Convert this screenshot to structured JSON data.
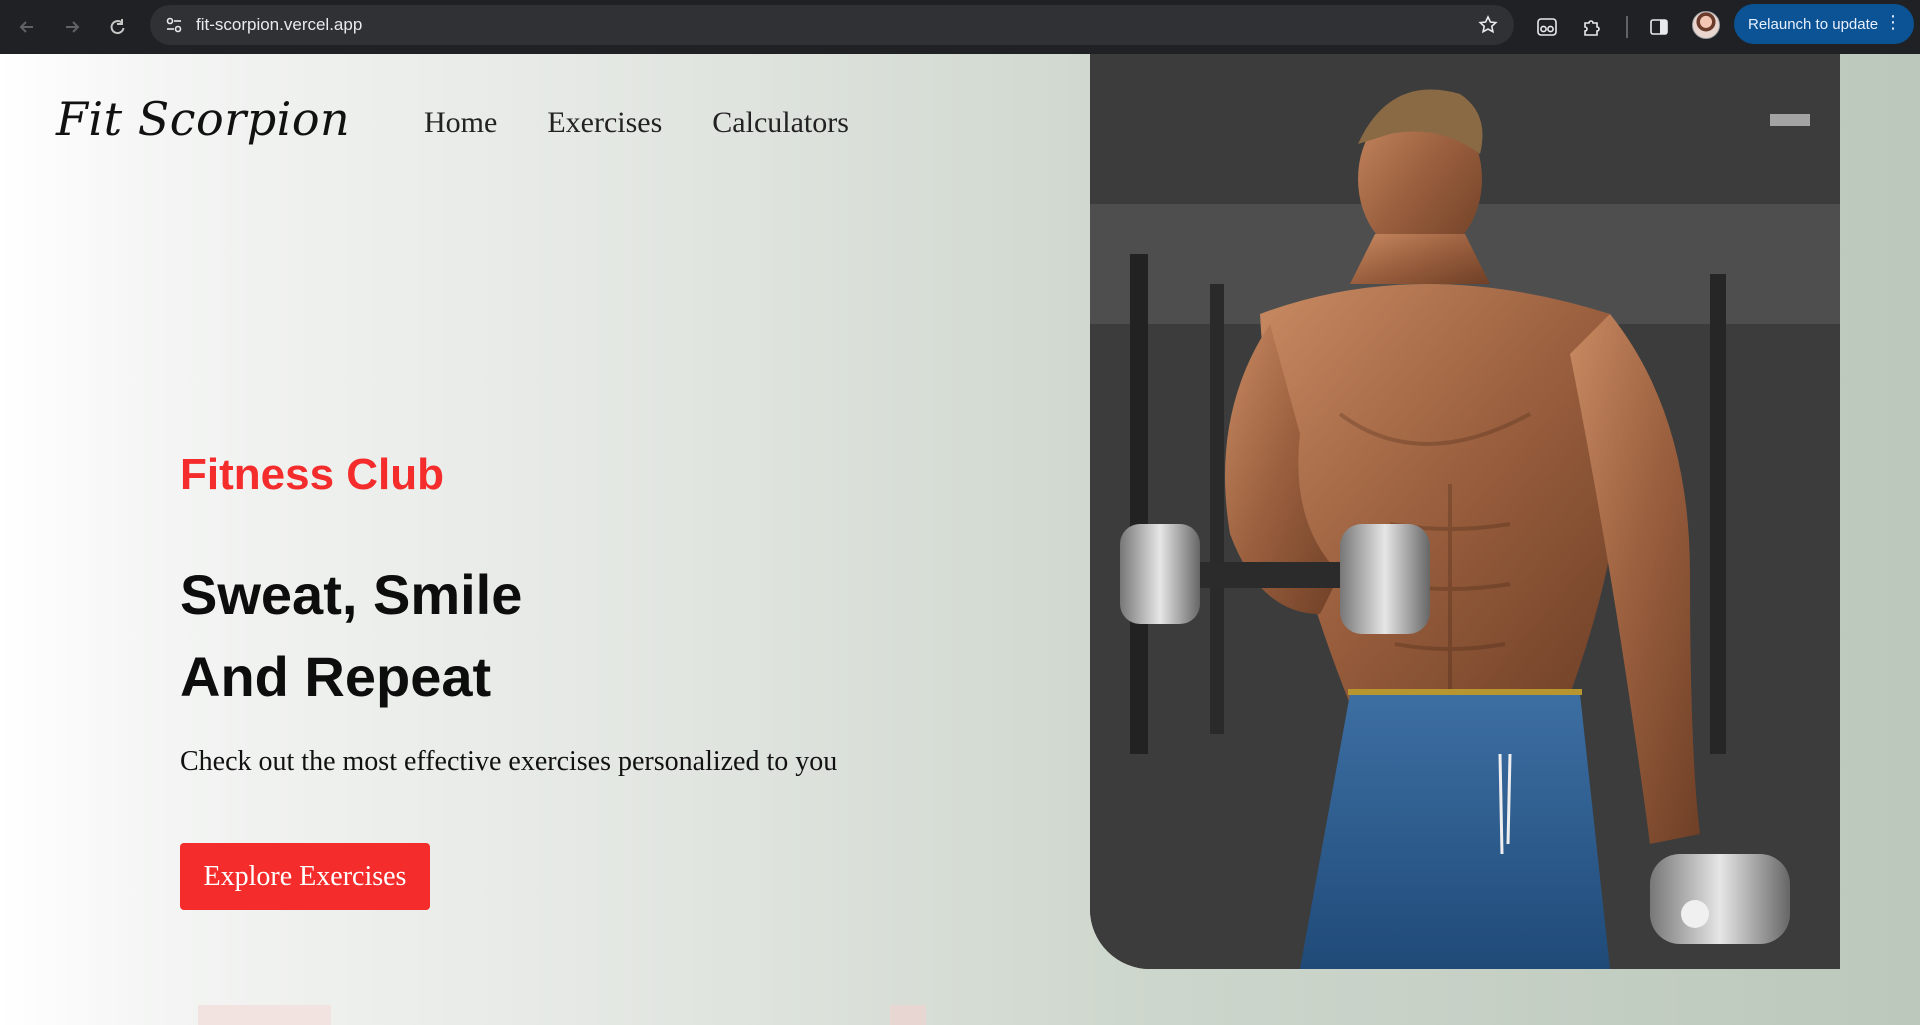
{
  "browser": {
    "url": "fit-scorpion.vercel.app",
    "relaunch_label": "Relaunch to update",
    "icons": {
      "back": "back-arrow-icon",
      "forward": "forward-arrow-icon",
      "reload": "reload-icon",
      "site_info": "tune-icon",
      "bookmark": "star-icon",
      "reading_mode": "glasses-icon",
      "extensions": "puzzle-icon",
      "side_panel": "side-panel-icon",
      "menu": "kebab-menu-icon"
    },
    "colors": {
      "toolbar": "#202124",
      "omnibox": "#303134",
      "relaunch": "#0b5394"
    }
  },
  "site": {
    "logo": "Fit Scorpion",
    "nav": [
      {
        "label": "Home"
      },
      {
        "label": "Exercises"
      },
      {
        "label": "Calculators"
      }
    ],
    "hero": {
      "eyebrow": "Fitness Club",
      "headline_line1": "Sweat, Smile",
      "headline_line2": "And Repeat",
      "subtitle": "Check out the most effective exercises personalized to you",
      "cta_label": "Explore Exercises",
      "image": "hero-bodybuilder-image"
    },
    "colors": {
      "accent": "#f42c2c",
      "text": "#0d0d0d"
    }
  }
}
